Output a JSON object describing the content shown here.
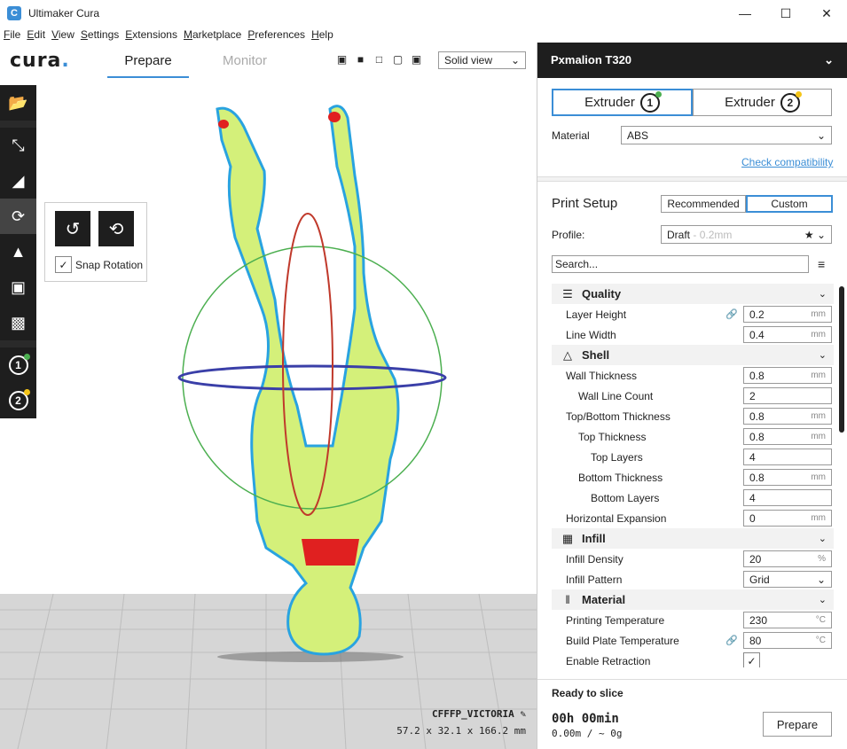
{
  "window": {
    "title": "Ultimaker Cura",
    "app_icon": "C"
  },
  "menu": [
    "File",
    "Edit",
    "View",
    "Settings",
    "Extensions",
    "Marketplace",
    "Preferences",
    "Help"
  ],
  "header": {
    "logo": "cura",
    "tab_prepare": "Prepare",
    "tab_monitor": "Monitor",
    "view_mode": "Solid view"
  },
  "rotate_panel": {
    "snap_label": "Snap Rotation",
    "snap_checked": true
  },
  "model": {
    "name": "CFFFP_VICTORIA",
    "dimensions": "57.2 x 32.1 x 166.2 mm"
  },
  "machine": {
    "name": "Pxmalion T320"
  },
  "extruders": [
    {
      "label": "Extruder",
      "number": "1",
      "status_color": "#4caf50"
    },
    {
      "label": "Extruder",
      "number": "2",
      "status_color": "#f5c518"
    }
  ],
  "material": {
    "label": "Material",
    "value": "ABS",
    "check_link": "Check compatibility"
  },
  "print_setup": {
    "title": "Print Setup",
    "mode_recommended": "Recommended",
    "mode_custom": "Custom",
    "profile_label": "Profile:",
    "profile_value": "Draft",
    "profile_sub": "0.2mm",
    "search_placeholder": "Search..."
  },
  "settings": {
    "quality": {
      "title": "Quality",
      "layer_height": {
        "label": "Layer Height",
        "value": "0.2",
        "unit": "mm"
      },
      "line_width": {
        "label": "Line Width",
        "value": "0.4",
        "unit": "mm"
      }
    },
    "shell": {
      "title": "Shell",
      "wall_thickness": {
        "label": "Wall Thickness",
        "value": "0.8",
        "unit": "mm"
      },
      "wall_line_count": {
        "label": "Wall Line Count",
        "value": "2"
      },
      "top_bottom_thickness": {
        "label": "Top/Bottom Thickness",
        "value": "0.8",
        "unit": "mm"
      },
      "top_thickness": {
        "label": "Top Thickness",
        "value": "0.8",
        "unit": "mm"
      },
      "top_layers": {
        "label": "Top Layers",
        "value": "4"
      },
      "bottom_thickness": {
        "label": "Bottom Thickness",
        "value": "0.8",
        "unit": "mm"
      },
      "bottom_layers": {
        "label": "Bottom Layers",
        "value": "4"
      },
      "horizontal_expansion": {
        "label": "Horizontal Expansion",
        "value": "0",
        "unit": "mm"
      }
    },
    "infill": {
      "title": "Infill",
      "density": {
        "label": "Infill Density",
        "value": "20",
        "unit": "%"
      },
      "pattern": {
        "label": "Infill Pattern",
        "value": "Grid"
      }
    },
    "material": {
      "title": "Material",
      "print_temp": {
        "label": "Printing Temperature",
        "value": "230",
        "unit": "°C"
      },
      "plate_temp": {
        "label": "Build Plate Temperature",
        "value": "80",
        "unit": "°C"
      },
      "retraction": {
        "label": "Enable Retraction",
        "checked": true
      }
    }
  },
  "slice": {
    "status": "Ready to slice",
    "time": "00h 00min",
    "material": "0.00m / ~ 0g",
    "button": "Prepare"
  }
}
